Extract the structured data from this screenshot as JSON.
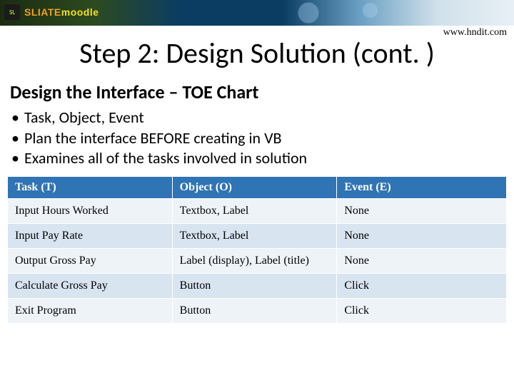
{
  "banner": {
    "brand_badge": "SL",
    "brand_text_a": "SLIATE",
    "brand_text_b": "moodle"
  },
  "url": "www.hndit.com",
  "title": "Step 2:  Design Solution (cont. )",
  "subtitle": "Design the Interface – TOE Chart",
  "bullets": [
    "Task, Object, Event",
    "Plan the interface BEFORE creating in VB",
    "Examines all of the tasks involved in solution"
  ],
  "table": {
    "headers": [
      "Task (T)",
      "Object (O)",
      "Event (E)"
    ],
    "rows": [
      [
        "Input Hours Worked",
        "Textbox, Label",
        "None"
      ],
      [
        "Input Pay Rate",
        "Textbox, Label",
        "None"
      ],
      [
        "Output Gross Pay",
        "Label (display), Label (title)",
        "None"
      ],
      [
        "Calculate Gross Pay",
        "Button",
        "Click"
      ],
      [
        "Exit Program",
        "Button",
        "Click"
      ]
    ]
  }
}
